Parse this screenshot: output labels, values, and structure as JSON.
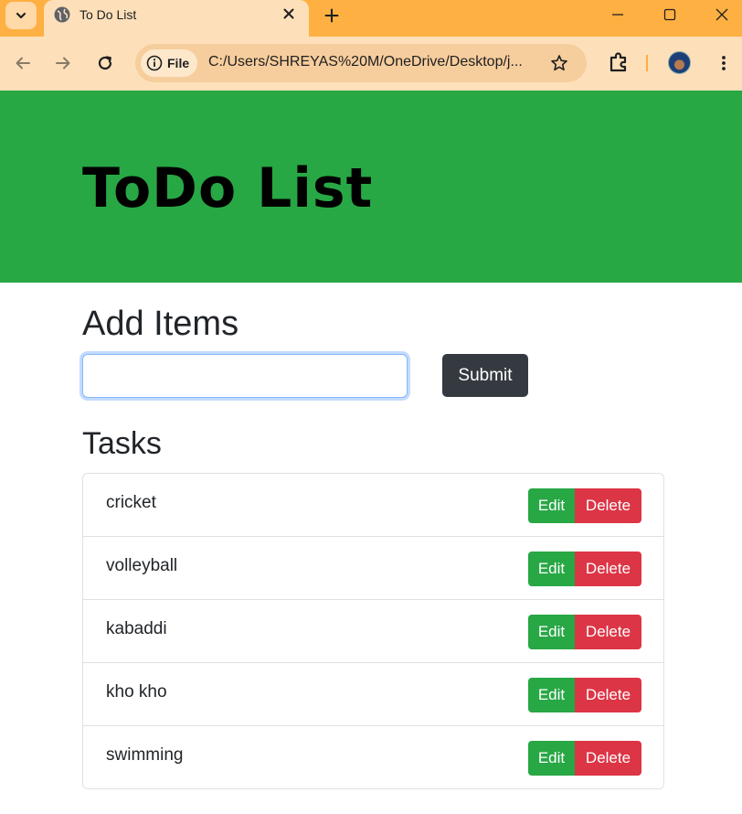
{
  "browser": {
    "tab_title": "To Do List",
    "site_chip_label": "File",
    "url": "C:/Users/SHREYAS%20M/OneDrive/Desktop/j...",
    "icons": [
      "tab-search-icon",
      "globe-icon",
      "close-icon",
      "plus-icon",
      "minimize-icon",
      "maximize-icon",
      "window-close-icon",
      "back-arrow-icon",
      "forward-arrow-icon",
      "reload-icon",
      "info-icon",
      "star-icon",
      "extensions-icon",
      "profile-avatar",
      "menu-dots-icon"
    ],
    "accent_color": "#ffb042"
  },
  "page": {
    "title": "ToDo List",
    "add_heading": "Add Items",
    "input_value": "",
    "submit_label": "Submit",
    "tasks_heading": "Tasks",
    "tasks": [
      {
        "label": "cricket",
        "edit": "Edit",
        "delete": "Delete"
      },
      {
        "label": "volleyball",
        "edit": "Edit",
        "delete": "Delete"
      },
      {
        "label": "kabaddi",
        "edit": "Edit",
        "delete": "Delete"
      },
      {
        "label": "kho kho",
        "edit": "Edit",
        "delete": "Delete"
      },
      {
        "label": "swimming",
        "edit": "Edit",
        "delete": "Delete"
      }
    ],
    "colors": {
      "hero": "#28a745",
      "edit": "#28a745",
      "delete": "#dc3545",
      "submit": "#343a40"
    }
  }
}
